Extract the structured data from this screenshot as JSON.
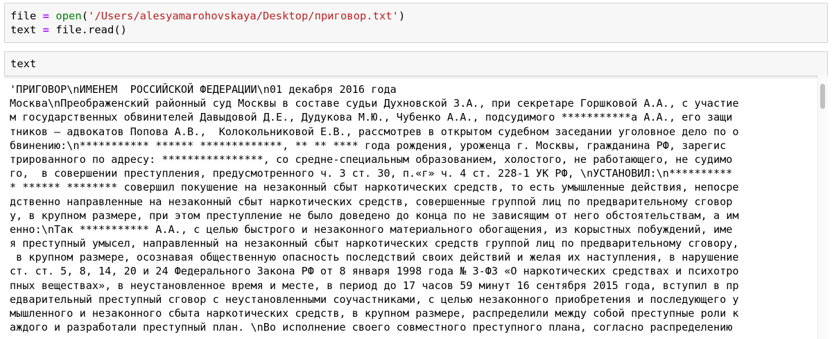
{
  "cells": {
    "cell1": {
      "line1": {
        "var": "file",
        "eq": "=",
        "func": "open",
        "paren_open": "(",
        "string": "'/Users/alesyamarohovskaya/Desktop/приговор.txt'",
        "paren_close": ")"
      },
      "line2": {
        "var": "text",
        "eq": "=",
        "call": "file.read()"
      }
    },
    "cell2": {
      "code": "text"
    }
  },
  "output": {
    "lines": [
      "'ПРИГОВОР\\nИМЕНЕМ  РОССИЙСКОЙ ФЕДЕРАЦИИ\\n01 декабря 2016 года",
      "Москва\\nПреображенский районный суд Москвы в составе судьи Духновской З.А., при секретаре Горшковой А.А., с участие",
      "м государственных обвинителей Давыдовой Д.Е., Дудукова М.Ю., Чубенко А.А., подсудимого ***********а А.А., его защи",
      "тников — адвокатов Попова А.В.,  Колокольниковой Е.В., рассмотрев в открытом судебном заседании уголовное дело по о",
      "бвинению:\\n*********** ****** *************, ** ** **** года рождения, уроженца г. Москвы, гражданина РФ, зарегис",
      "трированного по адресу: ****************, со средне-специальным образованием, холостого, не работающего, не судимо",
      "го,  в совершении преступления, предусмотренного ч. 3 ст. 30, п.«г» ч. 4 ст. 228-1 УК РФ, \\nУСТАНОВИЛ:\\n**********",
      "* ****** ******** совершил покушение на незаконный сбыт наркотических средств, то есть умышленные действия, непосре",
      "дственно направленные на незаконный сбыт наркотических средств, совершенные группой лиц по предварительному сговор",
      "у, в крупном размере, при этом преступление не было доведено до конца по не зависящим от него обстоятельствам, а им",
      "енно:\\nТак *********** А.А., с целью быстрого и незаконного материального обогащения, из корыстных побуждений, име",
      "я преступный умысел, направленный на незаконный сбыт наркотических средств группой лиц по предварительному сговору,",
      " в крупном размере, осознавая общественную опасность последствий своих действий и желая их наступления, в нарушение",
      "ст. ст. 5, 8, 14, 20 и 24 Федерального Закона РФ от 8 января 1998 года № 3-ФЗ «О наркотических средствах и психотро",
      "пных веществах», в неустановленное время и месте, в период до 17 часов 59 минут 16 сентября 2015 года, вступил в пр",
      "едварительный преступный сговор с неустановленными соучастниками, с целью незаконного приобретения и последующего у",
      "мышленного и незаконного сбыта наркотических средств, в крупном размере, распределили между собой преступные роли к",
      "аждого и разработали преступный план. \\nВо исполнение своего совместного преступного плана, согласно распределению"
    ]
  }
}
